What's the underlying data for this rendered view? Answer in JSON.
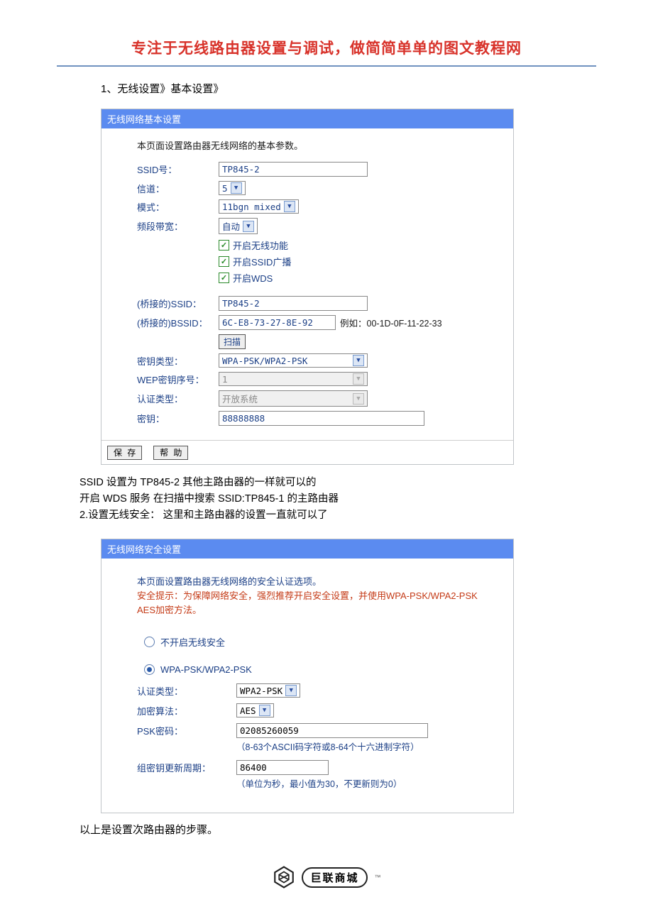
{
  "title": "专注于无线路由器设置与调试，做简简单单的图文教程网",
  "step1": "1、无线设置》基本设置》",
  "panel1": {
    "header": "无线网络基本设置",
    "desc": "本页面设置路由器无线网络的基本参数。",
    "ssid_label": "SSID号：",
    "ssid_value": "TP845-2",
    "channel_label": "信道：",
    "channel_value": "5",
    "mode_label": "模式：",
    "mode_value": "11bgn mixed",
    "bw_label": "频段带宽：",
    "bw_value": "自动",
    "cb1": "开启无线功能",
    "cb2": "开启SSID广播",
    "cb3": "开启WDS",
    "bridge_ssid_label": "(桥接的)SSID：",
    "bridge_ssid_value": "TP845-2",
    "bridge_bssid_label": "(桥接的)BSSID：",
    "bridge_bssid_value": "6C-E8-73-27-8E-92",
    "bridge_bssid_hint": "例如：00-1D-0F-11-22-33",
    "scan_btn": "扫描",
    "keytype_label": "密钥类型：",
    "keytype_value": "WPA-PSK/WPA2-PSK",
    "wepidx_label": "WEP密钥序号：",
    "wepidx_value": "1",
    "auth_label": "认证类型：",
    "auth_value": "开放系统",
    "key_label": "密钥：",
    "key_value": "88888888",
    "save_btn": "保 存",
    "help_btn": "帮 助"
  },
  "explain": {
    "l1": "SSID 设置为 TP845-2    其他主路由器的一样就可以的",
    "l2": "开启 WDS 服务    在扫描中搜索 SSID:TP845-1 的主路由器",
    "l3": "2.设置无线安全：  这里和主路由器的设置一直就可以了"
  },
  "panel2": {
    "header": "无线网络安全设置",
    "desc1": "本页面设置路由器无线网络的安全认证选项。",
    "desc2": "安全提示：为保障网络安全，强烈推荐开启安全设置，并使用WPA-PSK/WPA2-PSK AES加密方法。",
    "opt_off": "不开启无线安全",
    "opt_wpa": "WPA-PSK/WPA2-PSK",
    "auth_label": "认证类型：",
    "auth_value": "WPA2-PSK",
    "enc_label": "加密算法：",
    "enc_value": "AES",
    "psk_label": "PSK密码：",
    "psk_value": "02085260059",
    "psk_hint": "（8-63个ASCII码字符或8-64个十六进制字符）",
    "gk_label": "组密钥更新周期：",
    "gk_value": "86400",
    "gk_hint": "（单位为秒，最小值为30，不更新则为0）"
  },
  "footer_text": "以上是设置次路由器的步骤。",
  "logo_text": "巨联商城"
}
